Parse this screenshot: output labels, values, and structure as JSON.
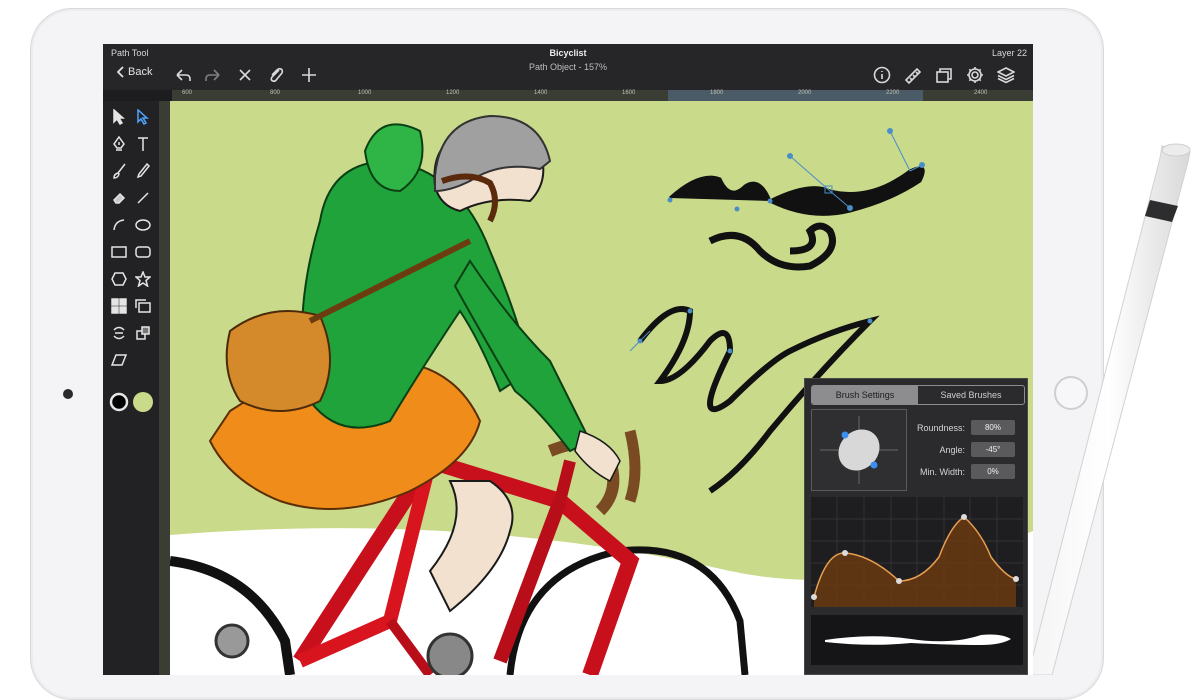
{
  "header": {
    "left_label": "Path Tool",
    "title": "Bicyclist",
    "subtitle": "Path Object - 157%",
    "right_label": "Layer 22",
    "back_label": "Back"
  },
  "toolbar_icons": [
    "undo-icon",
    "redo-icon",
    "close-icon",
    "attach-icon",
    "add-icon",
    "info-icon",
    "ruler-icon",
    "layers-stack-icon",
    "gear-icon",
    "layers-icon"
  ],
  "ruler": {
    "ticks": [
      "600",
      "800",
      "1000",
      "1200",
      "1400",
      "1600",
      "1800",
      "2000",
      "2200",
      "2400"
    ]
  },
  "colors": {
    "canvas_bg": "#c9da8a",
    "primary_color": "#000000",
    "secondary_color": "#c9da8a",
    "ui_dark": "#262628",
    "curve_accent": "#e8a050"
  },
  "panel": {
    "tab_brush": "Brush Settings",
    "tab_saved": "Saved Brushes",
    "roundness_label": "Roundness:",
    "roundness_value": "80%",
    "angle_label": "Angle:",
    "angle_value": "-45°",
    "minwidth_label": "Min. Width:",
    "minwidth_value": "0%"
  }
}
